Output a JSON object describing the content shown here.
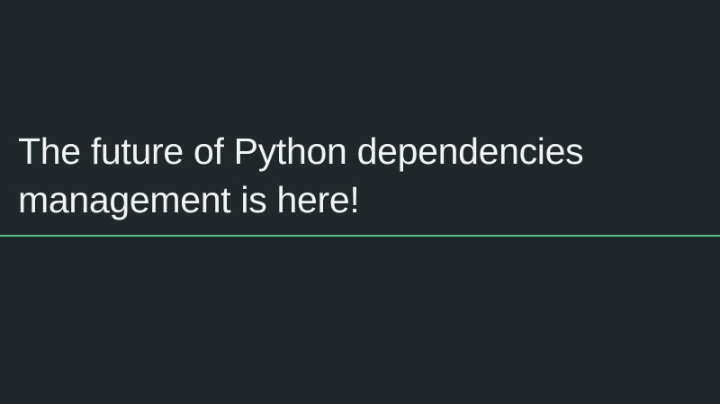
{
  "slide": {
    "title_lines": [
      "The future of Python dependencies",
      "management is here!"
    ]
  },
  "colors": {
    "background": "#21282b",
    "text": "#f2f4f4",
    "accent_line": "#5cc08a"
  }
}
